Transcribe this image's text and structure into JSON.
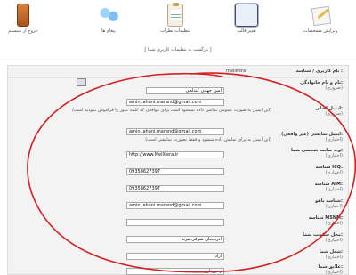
{
  "toolbar": {
    "items": [
      {
        "label": "خروج از سیستم",
        "icon": "logout-door-icon"
      },
      {
        "label": "پیغام ها",
        "icon": "messages-people-icon"
      },
      {
        "label": "تنظیمات نظرات",
        "icon": "clipboard-icon"
      },
      {
        "label": "تغییر قالب",
        "icon": "theme-picture-icon"
      },
      {
        "label": "ویرایش مشخصات",
        "icon": "edit-profile-icon"
      }
    ],
    "back_link": "[ بازگشت به تنظیمات کاربری شما ]"
  },
  "form": {
    "username": {
      "label": "نام کاربری / شناسه :",
      "value": "mellifera"
    },
    "fullname": {
      "label": "نام و نام خانوادگی:",
      "sub": "(ضروری)",
      "value": "امین جهانی کندلجی"
    },
    "email": {
      "label": "ایمیل اصلی:",
      "sub": "(ضروری)",
      "value": "amin.jahani.marand@gmail.com",
      "hint": "(این ایمیل به صورت عمومی نمایش داده نمیشود است برای مواقعی که کلمه عبور را فراموش نمودید است)"
    },
    "display_email": {
      "label": "ایمیل نمایشی (غیر واقعی):",
      "sub": "(اختیاری)",
      "value": "amin.jahani.marand@gmail.com",
      "hint": "(این ایمیل به برای نمایش داده میشود و فقط بصورت نمایشی است)"
    },
    "website": {
      "label": "وب سایت شخصی شما:",
      "sub": "(اختیاری)",
      "value": "http://www.Mellifera.ir"
    },
    "icq": {
      "label": "شناسه ICQ:",
      "sub": "(اختیاری)",
      "value": "09358627397"
    },
    "aim": {
      "label": "شناسه AIM:",
      "sub": "(اختیاری)",
      "value": "09358627397"
    },
    "yahoo": {
      "label": "شناسه یاهو:",
      "sub": "(اختیاری)",
      "value": "amin.jahani.marand@gmail.com"
    },
    "msnm": {
      "label": "شناسه MSNM:",
      "sub": "(اختیاری)",
      "value": ""
    },
    "location": {
      "label": "محل سکونت شما:",
      "sub": "(اختیاری)",
      "value": "آذربایجان شرقی-مرند"
    },
    "job": {
      "label": "شغل شما:",
      "sub": "(اختیاری)",
      "value": "آزاد"
    },
    "interests": {
      "label": "علایق شما:",
      "sub": "(اختیاری)",
      "value": "زنبورداری"
    }
  },
  "colors": {
    "annotation": "#d42020",
    "panel": "#f3f3f3"
  }
}
